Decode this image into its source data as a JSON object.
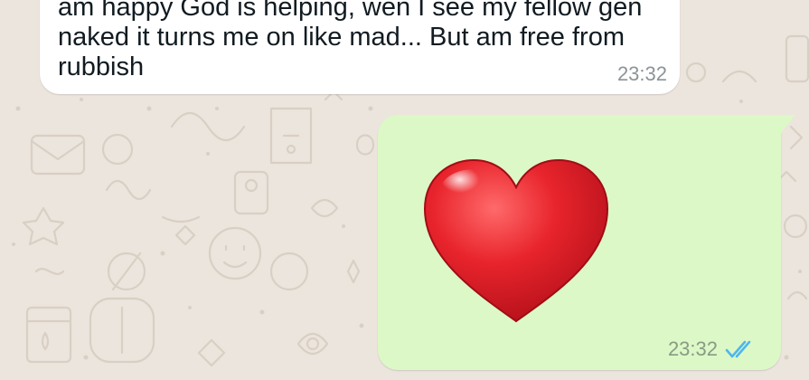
{
  "chat": {
    "background_color": "#ece5dd",
    "messages": [
      {
        "direction": "incoming",
        "text": "am happy God is helping, wen I see my fellow gen\nnaked it turns me on like mad... But am free from\nrubbish",
        "time": "23:32"
      },
      {
        "direction": "outgoing",
        "emoji": "red-heart",
        "time": "23:32",
        "status": "read-double-tick"
      }
    ]
  },
  "colors": {
    "incoming_bubble": "#ffffff",
    "outgoing_bubble": "#dcf8c6",
    "read_tick": "#4fb6ec",
    "heart": "#e0202a"
  }
}
